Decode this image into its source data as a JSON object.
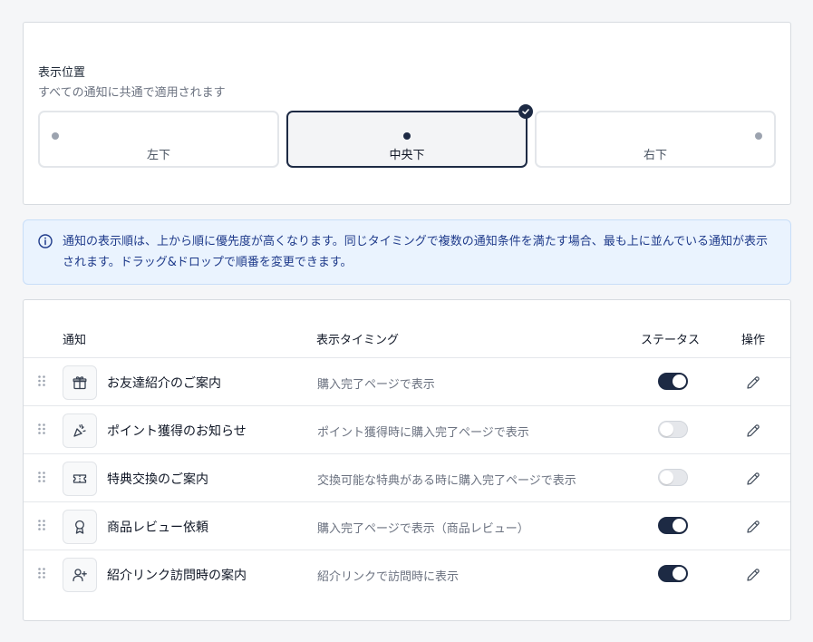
{
  "position": {
    "title": "表示位置",
    "description": "すべての通知に共通で適用されます",
    "options": [
      {
        "label": "左下",
        "selected": false
      },
      {
        "label": "中央下",
        "selected": true
      },
      {
        "label": "右下",
        "selected": false
      }
    ]
  },
  "info": {
    "icon": "info-icon",
    "text": "通知の表示順は、上から順に優先度が高くなります。同じタイミングで複数の通知条件を満たす場合、最も上に並んでいる通知が表示されます。ドラッグ&ドロップで順番を変更できます。"
  },
  "table": {
    "headers": {
      "notice": "通知",
      "timing": "表示タイミング",
      "status": "ステータス",
      "action": "操作"
    },
    "rows": [
      {
        "name": "お友達紹介のご案内",
        "timing": "購入完了ページで表示",
        "enabled": true,
        "icon": "gift-icon"
      },
      {
        "name": "ポイント獲得のお知らせ",
        "timing": "ポイント獲得時に購入完了ページで表示",
        "enabled": false,
        "icon": "party-popper-icon"
      },
      {
        "name": "特典交換のご案内",
        "timing": "交換可能な特典がある時に購入完了ページで表示",
        "enabled": false,
        "icon": "ticket-icon"
      },
      {
        "name": "商品レビュー依頼",
        "timing": "購入完了ページで表示（商品レビュー）",
        "enabled": true,
        "icon": "award-icon"
      },
      {
        "name": "紹介リンク訪問時の案内",
        "timing": "紹介リンクで訪問時に表示",
        "enabled": true,
        "icon": "user-plus-icon"
      }
    ]
  },
  "colors": {
    "accent": "#1d2a44",
    "info_bg": "#eaf3fe",
    "info_text": "#1e3a8a"
  }
}
